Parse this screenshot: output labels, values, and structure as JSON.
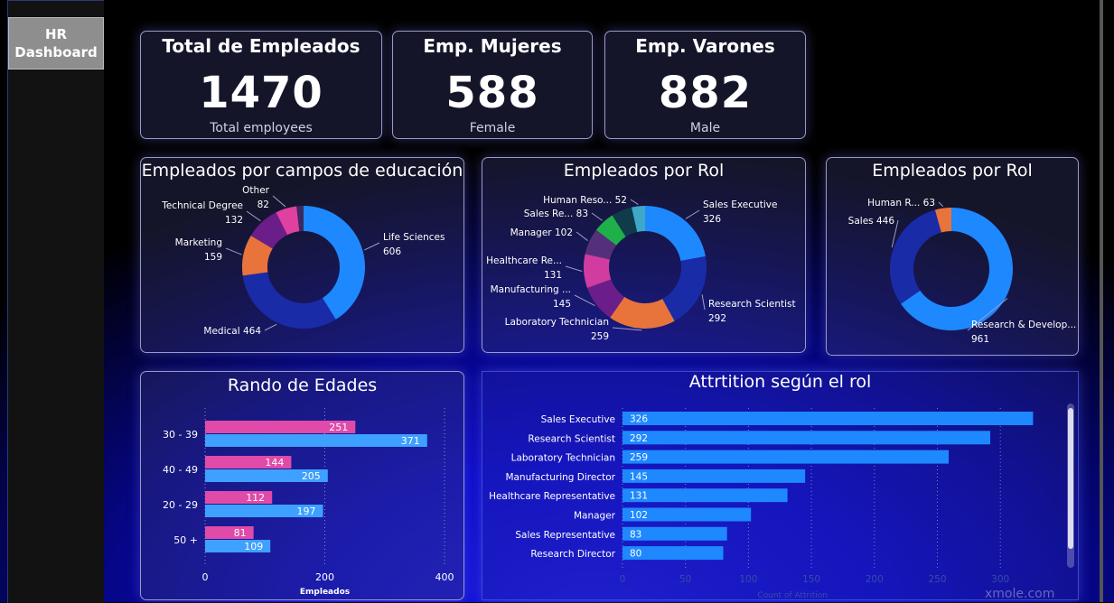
{
  "sidebar": {
    "nav_line1": "HR",
    "nav_line2": "Dashboard"
  },
  "kpis": [
    {
      "title": "Total de Empleados",
      "value": "1470",
      "subtitle": "Total employees"
    },
    {
      "title": "Emp. Mujeres",
      "value": "588",
      "subtitle": "Female"
    },
    {
      "title": "Emp. Varones",
      "value": "882",
      "subtitle": "Male"
    }
  ],
  "colors": {
    "blue": "#1e88ff",
    "navy": "#1a2ba8",
    "orange": "#e8743b",
    "purple": "#6b1d8a",
    "pink": "#e040a0",
    "magenta": "#d03ca0",
    "violet": "#55307a",
    "green": "#1fb04a",
    "darkteal": "#0f3b4a",
    "teal": "#3fa7c8",
    "bar_blue": "#1e88ff",
    "bar_light": "#3ea0ff",
    "bar_pink": "#e04aa8"
  },
  "watermark": "xmole.com",
  "chart_data": [
    {
      "type": "pie",
      "title": "Empleados por campos de educación",
      "slices": [
        {
          "label": "Life Sciences",
          "value": 606,
          "color": "#1e88ff"
        },
        {
          "label": "Medical",
          "value": 464,
          "color": "#1a2ba8"
        },
        {
          "label": "Marketing",
          "value": 159,
          "color": "#e8743b"
        },
        {
          "label": "Technical Degree",
          "value": 132,
          "color": "#6b1d8a"
        },
        {
          "label": "Other",
          "value": 82,
          "color": "#e040a0"
        },
        {
          "label": "",
          "value": 27,
          "color": "#3a2a60"
        }
      ]
    },
    {
      "type": "pie",
      "title": "Empleados por Rol",
      "slices": [
        {
          "label": "Sales Executive",
          "value": 326,
          "color": "#1e88ff"
        },
        {
          "label": "Research Scientist",
          "value": 292,
          "color": "#1a2ba8"
        },
        {
          "label": "Laboratory Technician",
          "value": 259,
          "color": "#e8743b"
        },
        {
          "label": "Manufacturing ...",
          "value": 145,
          "color": "#6b1d8a"
        },
        {
          "label": "Healthcare Re...",
          "value": 131,
          "color": "#d03ca0"
        },
        {
          "label": "Manager",
          "value": 102,
          "color": "#55307a"
        },
        {
          "label": "Sales Re...",
          "value": 83,
          "color": "#1fb04a"
        },
        {
          "label": "",
          "value": 80,
          "color": "#0f3b4a"
        },
        {
          "label": "Human Reso...",
          "value": 52,
          "color": "#3fa7c8"
        }
      ]
    },
    {
      "type": "pie",
      "title": "Empleados por Rol",
      "slices": [
        {
          "label": "Research & Develop...",
          "value": 961,
          "color": "#1e88ff"
        },
        {
          "label": "Sales",
          "value": 446,
          "color": "#1a2ba8"
        },
        {
          "label": "Human R...",
          "value": 63,
          "color": "#e8743b"
        }
      ]
    },
    {
      "type": "bar",
      "orientation": "horizontal",
      "title": "Rando de Edades",
      "xlabel": "Empleados",
      "categories": [
        "30 - 39",
        "40 - 49",
        "20 - 29",
        "50 +"
      ],
      "series": [
        {
          "values": [
            251,
            144,
            112,
            81
          ],
          "color": "#e04aa8"
        },
        {
          "values": [
            371,
            205,
            197,
            109
          ],
          "color": "#3ea0ff"
        }
      ],
      "xlim": [
        0,
        400
      ],
      "xticks": [
        "0",
        "200",
        "400"
      ]
    },
    {
      "type": "bar",
      "orientation": "horizontal",
      "title": "Attrtition según el rol",
      "xlabel": "Count of Attrition",
      "categories": [
        "Sales Executive",
        "Research Scientist",
        "Laboratory Technician",
        "Manufacturing Director",
        "Healthcare Representative",
        "Manager",
        "Sales Representative",
        "Research Director"
      ],
      "values": [
        326,
        292,
        259,
        145,
        131,
        102,
        83,
        80
      ],
      "xlim": [
        0,
        330
      ],
      "xticks": [
        "0",
        "50",
        "100",
        "150",
        "200",
        "250",
        "300"
      ]
    }
  ]
}
